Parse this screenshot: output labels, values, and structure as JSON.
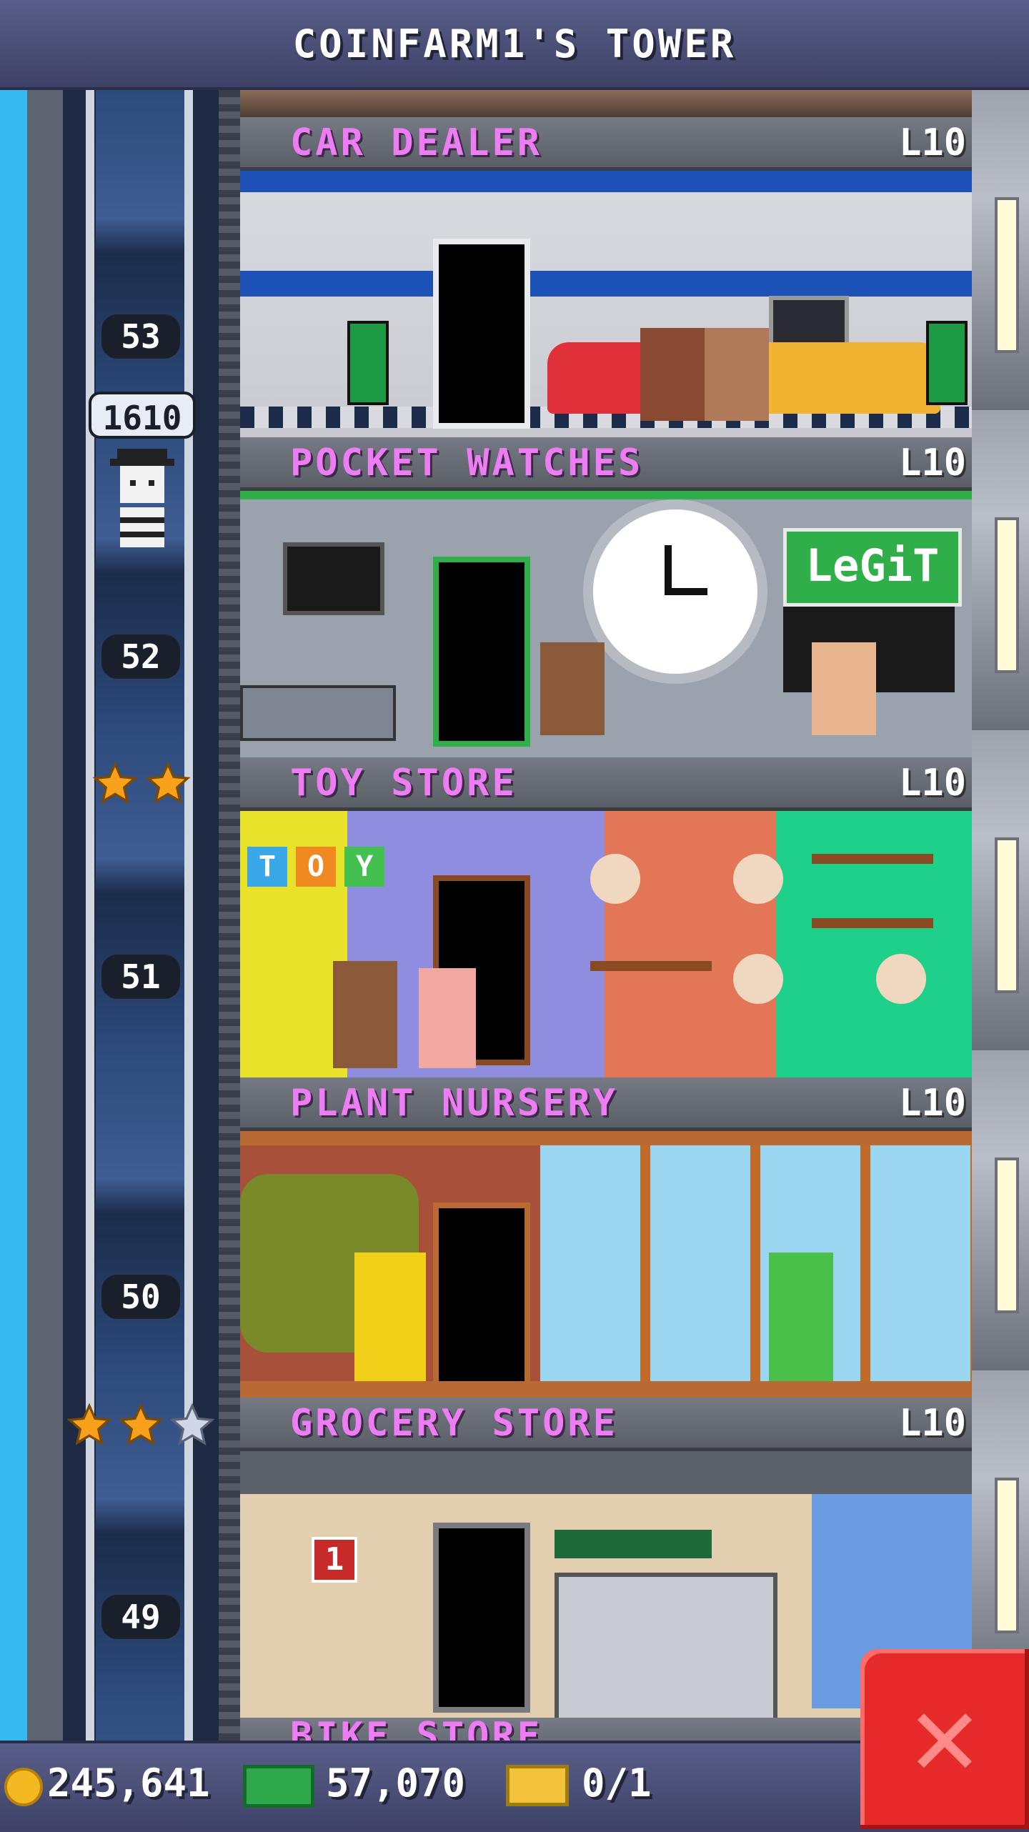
{
  "header": {
    "title": "COINFARM1'S TOWER"
  },
  "elevator": {
    "count": "1610"
  },
  "floors": [
    {
      "number": "53",
      "name": "CAR DEALER",
      "level": "L10"
    },
    {
      "number": "52",
      "name": "POCKET WATCHES",
      "level": "L10",
      "sign": "LeGiT"
    },
    {
      "number": "51",
      "name": "TOY STORE",
      "level": "L10",
      "blocks": [
        "T",
        "O",
        "Y"
      ]
    },
    {
      "number": "50",
      "name": "PLANT NURSERY",
      "level": "L10"
    },
    {
      "number": "49",
      "name": "GROCERY STORE",
      "level": "L10",
      "sign_number": "1"
    }
  ],
  "next_floor_partial": "BIKE STORE",
  "stars": {
    "toy_store_row": {
      "gold": 2,
      "silver": 0
    },
    "grocery_row": {
      "gold": 2,
      "silver": 1
    }
  },
  "footer": {
    "coins": "245,641",
    "bux": "57,070",
    "tickets": "0/1"
  },
  "icons": {
    "coin": "coin-icon",
    "bux": "bux-icon",
    "ticket": "golden-ticket-icon",
    "close": "close-icon",
    "star": "star-icon"
  },
  "colors": {
    "floor_name": "#ee7cf4",
    "close_button": "#e62a2a",
    "sky": "#38b8f0"
  }
}
